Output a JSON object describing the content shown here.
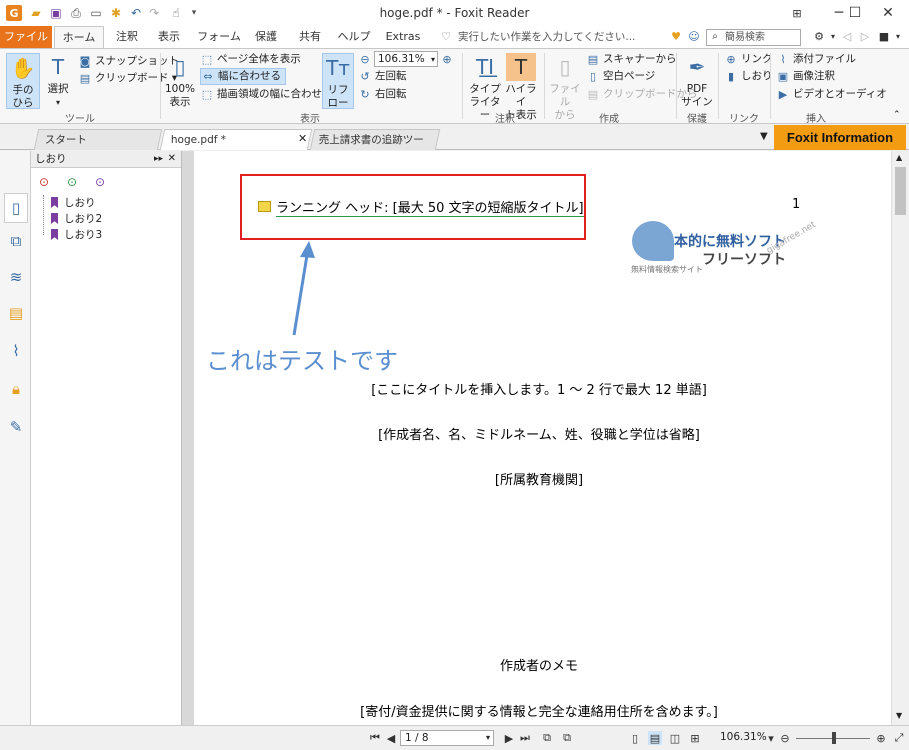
{
  "window": {
    "title": "hoge.pdf * - Foxit Reader"
  },
  "ribbon_tabs": [
    "ファイル",
    "ホーム",
    "注釈",
    "表示",
    "フォーム",
    "保護",
    "共有",
    "ヘルプ",
    "Extras"
  ],
  "tell_me": "実行したい作業を入力してください...",
  "search": {
    "placeholder": "簡易検索"
  },
  "ribbon": {
    "tools_group": {
      "label": "ツール",
      "hand": "手の\nひら",
      "hand_l1": "手の",
      "hand_l2": "ひら",
      "select": "選択",
      "snapshot": "スナップショット",
      "clipboard": "クリップボード ▾"
    },
    "view_group": {
      "label": "表示",
      "actual_size_l1": "100%",
      "actual_size_l2": "表示",
      "fit_page": "ページ全体を表示",
      "fit_width": "幅に合わせる",
      "fit_visible": "描画領域の幅に合わせる",
      "reflow_l1": "リフ",
      "reflow_l2": "ロー",
      "zoom_value": "106.31%",
      "rotate_left": "左回転",
      "rotate_right": "右回転"
    },
    "comment_group": {
      "label": "注釈",
      "typewriter_l1": "タイプ",
      "typewriter_l2": "ライター",
      "highlight_l1": "ハイライ",
      "highlight_l2": "ト表示"
    },
    "create_group": {
      "label": "作成",
      "from_file_l1": "ファイル",
      "from_file_l2": "から",
      "from_scanner": "スキャナーから",
      "blank_page": "空白ページ",
      "from_clipboard": "クリップボードから"
    },
    "protect_group": {
      "label": "保護",
      "pdf_sign_l1": "PDF",
      "pdf_sign_l2": "サイン"
    },
    "link_group": {
      "label": "リンク",
      "link": "リンク",
      "bookmark": "しおり"
    },
    "insert_group": {
      "label": "挿入",
      "attach": "添付ファイル",
      "image": "画像注釈",
      "video": "ビデオとオーディオ"
    }
  },
  "doc_tabs": [
    "スタート",
    "hoge.pdf *",
    "売上請求書の追跡ツール..."
  ],
  "foxit_info": "Foxit Information",
  "bookmarks": {
    "header": "しおり",
    "items": [
      "しおり",
      "しおり2",
      "しおり3"
    ]
  },
  "page": {
    "running_head": "ランニング ヘッド: [最大 50 文字の短縮版タイトル]",
    "page_number": "1",
    "annotation": "これはテストです",
    "title": "[ここにタイトルを挿入します。1 〜 2 行で最大 12 単語]",
    "authors": "[作成者名、名、ミドルネーム、姓、役職と学位は省略]",
    "institution": "[所属教育機関]",
    "author_note_heading": "作成者のメモ",
    "author_note": "[寄付/資金提供に関する情報と完全な連絡用住所を含めます。]",
    "watermark_l1": "本的に無料ソフト",
    "watermark_l2": "フリーソフト",
    "watermark_small": "無料情報検索サイト",
    "watermark_site": "gigafree.net"
  },
  "status": {
    "page_indicator": "1 / 8",
    "zoom": "106.31%"
  },
  "colors": {
    "file_tab": "#e8731a",
    "foxit_info_bg": "#f39c12",
    "red_box": "#e02020",
    "arrow": "#5b8fd0"
  }
}
